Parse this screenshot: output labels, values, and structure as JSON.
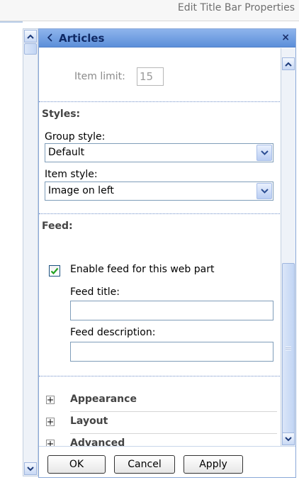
{
  "top_link": "Edit Title Bar Properties",
  "panel": {
    "title": "Articles",
    "close": "×"
  },
  "item_limit": {
    "label": "Item limit:",
    "value": "15"
  },
  "styles": {
    "title": "Styles:",
    "group_style_label": "Group style:",
    "group_style_value": "Default",
    "item_style_label": "Item style:",
    "item_style_value": "Image on left"
  },
  "feed": {
    "title": "Feed:",
    "enable_label": "Enable feed for this web part",
    "enable_checked": true,
    "feed_title_label": "Feed title:",
    "feed_title_value": "",
    "feed_description_label": "Feed description:",
    "feed_description_value": ""
  },
  "sections": [
    "Appearance",
    "Layout",
    "Advanced"
  ],
  "buttons": {
    "ok": "OK",
    "cancel": "Cancel",
    "apply": "Apply"
  },
  "icons": {
    "up_arrow": "arrow-up-icon",
    "down_arrow": "arrow-down-icon",
    "back": "back-arrow-icon",
    "check": "checkmark-icon",
    "expand": "plus-icon"
  }
}
